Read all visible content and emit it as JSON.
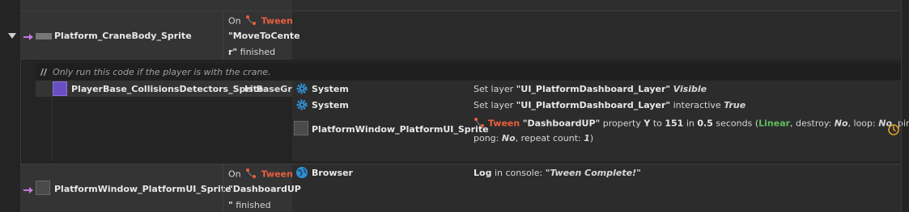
{
  "event1": {
    "object_name": "Platform_CraneBody_Sprite",
    "cond_on": "On",
    "cond_tween": "Tween",
    "cond_tween_name_1": "\"MoveToCente",
    "cond_tween_name_2": "r\"",
    "cond_finished": "finished"
  },
  "comment": {
    "slashes": "//",
    "text": "Only run this code if the player is with the crane."
  },
  "subevent": {
    "object_name": "PlayerBase_CollisionsDetectors_Sprite",
    "condition_text": "Is BaseGrab",
    "actions": [
      {
        "object": "System",
        "text_pre": "Set layer ",
        "text_name": "\"UI_PlatformDashboard_Layer\"",
        "text_post": "Visible"
      },
      {
        "object": "System",
        "text_pre": "Set layer ",
        "text_name": "\"UI_PlatformDashboard_Layer\"",
        "text_mid": " interactive ",
        "text_post": "True"
      },
      {
        "object": "PlatformWindow_PlatformUI_Sprite",
        "tween": "Tween",
        "name": "\"DashboardUP\"",
        "prop": " property ",
        "y": "Y",
        "to": " to ",
        "value": "151",
        "in": " in ",
        "secs": "0.5",
        "seconds": " seconds (",
        "linear": "Linear",
        "destroy": ", destroy: ",
        "no1": "No",
        "loop": ", loop: ",
        "no2": "No",
        "ping": ", ping",
        "pong": "pong: ",
        "no3": "No",
        "repeat": ", repeat count: ",
        "count": "1",
        "close": ")"
      }
    ]
  },
  "event2": {
    "object_name": "PlatformWindow_PlatformUI_Sprite",
    "cond_on": "On",
    "cond_tween": "Tween",
    "cond_tween_name_1": "\"DashboardUP",
    "cond_tween_name_2": "\"",
    "cond_finished": "finished",
    "action_object": "Browser",
    "action_log": "Log",
    "action_in": " in console: ",
    "action_msg": "\"Tween Complete!\""
  },
  "colors": {
    "accent_tween": "#e9603d",
    "linear_green": "#5ec05e",
    "system_icon": "#2f8fd0",
    "arrow_purple": "#c678dd",
    "timer_icon": "#e0a020"
  },
  "icons": {
    "expand": "triangle-down-icon",
    "arrow": "arrow-right-icon",
    "tween": "tween-icon",
    "system": "gear-icon",
    "browser": "globe-icon",
    "timer": "timer-icon"
  }
}
